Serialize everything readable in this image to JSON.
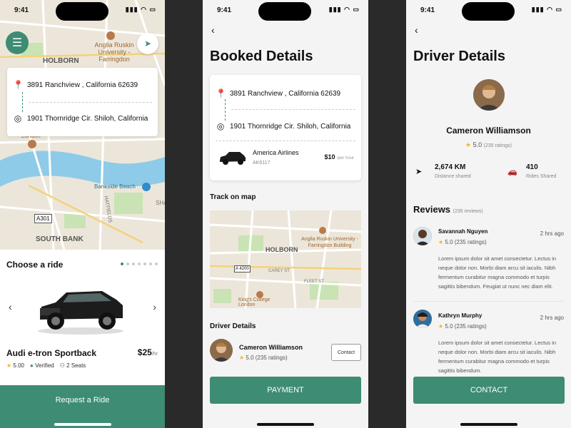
{
  "status": {
    "time": "9:41",
    "icons": "▮▮▮ ◠ ▭"
  },
  "screen1": {
    "map_labels": {
      "holborn": "HOLBORN",
      "uni": "Anglia Ruskin University - Farringdon",
      "london": "London",
      "bankside": "Bankside Beach",
      "south_bank": "SOUTH BANK",
      "a301": "A301",
      "hatfields": "HATFIELDS",
      "shadwell": "SHA"
    },
    "from_address": "3891 Ranchview , California 62639",
    "to_address": "1901 Thornridge Cir. Shiloh, California",
    "choose_title": "Choose a ride",
    "car_name": "Audi e-tron Sportback",
    "price": "$25",
    "price_unit": "/hr",
    "rating": "5.00",
    "verified": "Verified",
    "seats": "2 Seats",
    "request_button": "Request a Ride"
  },
  "screen2": {
    "title": "Booked Details",
    "from_address": "3891 Ranchview , California 62639",
    "to_address": "1901 Thornridge Cir. Shiloh, California",
    "airline": "America Airlines",
    "airline_code": "AK6117",
    "fare": "$10",
    "fare_unit": "/per hour",
    "track_title": "Track on map",
    "map_labels": {
      "uni": "Anglia Ruskin University - Farringdon Building",
      "holborn": "HOLBORN",
      "a4200": "A 4200",
      "carey": "CAREY ST",
      "fleet": "FLEET ST",
      "kings": "King's College London"
    },
    "driver_title": "Driver Details",
    "driver_name": "Cameron Williamson",
    "driver_rating": "5.0 (235 ratings)",
    "contact_small": "Contact",
    "payment_button": "PAYMENT"
  },
  "screen3": {
    "title": "Driver Details",
    "driver_name": "Cameron Williamson",
    "driver_rating": "5.0",
    "driver_ratings_count": "(235 ratings)",
    "distance_value": "2,674 KM",
    "distance_label": "Distance shared",
    "rides_value": "410",
    "rides_label": "Rides Shared",
    "reviews_title": "Reviews",
    "reviews_count": "(235 reviews)",
    "reviews": [
      {
        "name": "Savannah Nguyen",
        "rating": "5.0 (235 ratings)",
        "time": "2 hrs ago",
        "text": "Lorem ipsum dolor sit amet consectetur. Lectus in neque dolor non. Morbi diam arcu sit iaculis. Nibh fermentum curabitur magna commodo et turpis sagittis bibendum. Feugiat ut nunc nec diam elit."
      },
      {
        "name": "Kathryn Murphy",
        "rating": "5.0 (235 ratings)",
        "time": "2 hrs ago",
        "text": "Lorem ipsum dolor sit amet consectetur. Lectus in neque dolor non. Morbi diam arcu sit iaculis. Nibh fermentum curabitur magna commodo et turpis sagittis bibendum."
      }
    ],
    "contact_button": "CONTACT"
  },
  "colors": {
    "accent": "#3d8c73",
    "star": "#f0b429",
    "water": "#8ecbe8",
    "map_bg": "#ece6da"
  }
}
